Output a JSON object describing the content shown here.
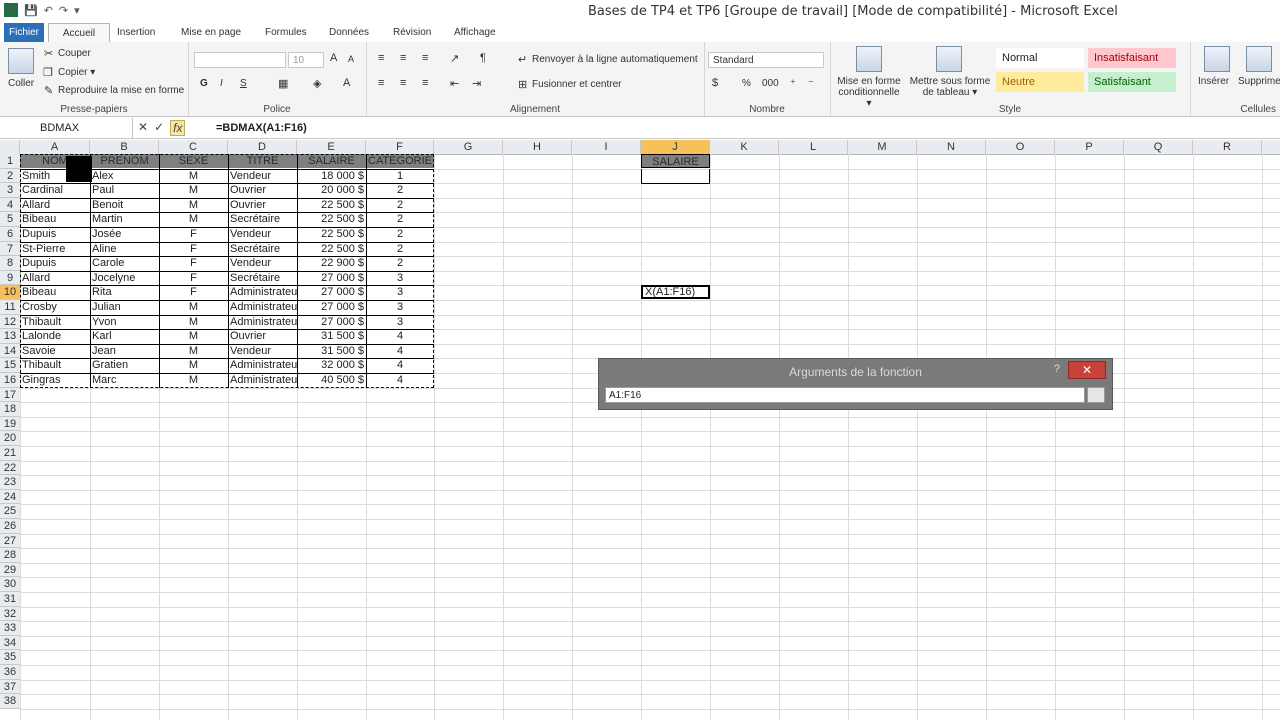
{
  "window": {
    "title": "Bases de TP4 et TP6  [Groupe de travail]  [Mode de compatibilité]  -  Microsoft Excel",
    "qat": [
      "X",
      "💾",
      "↶",
      "↷",
      "▾"
    ]
  },
  "tabs": [
    "Fichier",
    "Accueil",
    "Insertion",
    "Mise en page",
    "Formules",
    "Données",
    "Révision",
    "Affichage"
  ],
  "ribbon": {
    "clipboard": {
      "label": "Presse-papiers",
      "paste": "Coller",
      "cut": "Couper",
      "copy": "Copier ▾",
      "format_painter": "Reproduire la mise en forme"
    },
    "font": {
      "label": "Police",
      "size": "10",
      "bold": "G",
      "italic": "I",
      "underline": "S"
    },
    "alignment": {
      "label": "Alignement",
      "wrap": "Renvoyer à la ligne automatiquement",
      "merge": "Fusionner et centrer"
    },
    "number": {
      "label": "Nombre",
      "format": "Standard",
      "percent": "%",
      "thousands": "000"
    },
    "styles": {
      "label": "Style",
      "cond_format": "Mise en forme conditionnelle ▾",
      "table_format": "Mettre sous forme de tableau ▾",
      "cells": [
        {
          "name": "Normal",
          "bg": "#ffffff",
          "color": "#1e1e1e"
        },
        {
          "name": "Insatisfaisant",
          "bg": "#ffc7ce",
          "color": "#9c0006"
        },
        {
          "name": "Neutre",
          "bg": "#ffeb9c",
          "color": "#9c6500"
        },
        {
          "name": "Satisfaisant",
          "bg": "#c6efce",
          "color": "#006100"
        }
      ]
    },
    "cells": {
      "label": "Cellules",
      "insert": "Insérer",
      "delete": "Supprime"
    }
  },
  "formula_bar": {
    "name_box": "BDMAX",
    "formula": "=BDMAX(A1:F16)",
    "fx": "fx"
  },
  "columns": [
    "A",
    "B",
    "C",
    "D",
    "E",
    "F",
    "G",
    "H",
    "I",
    "J",
    "K",
    "L",
    "M",
    "N",
    "O",
    "P",
    "Q",
    "R"
  ],
  "rows": [
    "1",
    "2",
    "3",
    "4",
    "5",
    "6",
    "7",
    "8",
    "9",
    "10",
    "11",
    "12",
    "13",
    "14",
    "15",
    "16",
    "17",
    "18",
    "19",
    "20",
    "21",
    "22",
    "23",
    "24",
    "25",
    "26",
    "27",
    "28",
    "29",
    "30",
    "31",
    "32",
    "33",
    "34",
    "35",
    "36",
    "37",
    "38"
  ],
  "table": {
    "headers": [
      "NOM",
      "PRENOM",
      "SEXE",
      "TITRE",
      "SALAIRE",
      "CATEGORIE"
    ],
    "rows": [
      [
        "Smith",
        "Alex",
        "M",
        "Vendeur",
        "18 000  $",
        "1"
      ],
      [
        "Cardinal",
        "Paul",
        "M",
        "Ouvrier",
        "20 000  $",
        "2"
      ],
      [
        "Allard",
        "Benoit",
        "M",
        "Ouvrier",
        "22 500  $",
        "2"
      ],
      [
        "Bibeau",
        "Martin",
        "M",
        "Secrétaire",
        "22 500  $",
        "2"
      ],
      [
        "Dupuis",
        "Josée",
        "F",
        "Vendeur",
        "22 500  $",
        "2"
      ],
      [
        "St-Pierre",
        "Aline",
        "F",
        "Secrétaire",
        "22 500  $",
        "2"
      ],
      [
        "Dupuis",
        "Carole",
        "F",
        "Vendeur",
        "22 900  $",
        "2"
      ],
      [
        "Allard",
        "Jocelyne",
        "F",
        "Secrétaire",
        "27 000  $",
        "3"
      ],
      [
        "Bibeau",
        "Rita",
        "F",
        "Administrateu",
        "27 000  $",
        "3"
      ],
      [
        "Crosby",
        "Julian",
        "M",
        "Administrateu",
        "27 000  $",
        "3"
      ],
      [
        "Thibault",
        "Yvon",
        "M",
        "Administrateu",
        "27 000  $",
        "3"
      ],
      [
        "Lalonde",
        "Karl",
        "M",
        "Ouvrier",
        "31 500  $",
        "4"
      ],
      [
        "Savoie",
        "Jean",
        "M",
        "Vendeur",
        "31 500  $",
        "4"
      ],
      [
        "Thibault",
        "Gratien",
        "M",
        "Administrateu",
        "32 000  $",
        "4"
      ],
      [
        "Gingras",
        "Marc",
        "M",
        "Administrateu",
        "40 500  $",
        "4"
      ]
    ]
  },
  "criteria": {
    "header": "SALAIRE",
    "active_cell_text": "X(A1:F16)"
  },
  "dialog": {
    "title": "Arguments de la fonction",
    "help": "?",
    "close": "✕",
    "input": "A1:F16"
  }
}
